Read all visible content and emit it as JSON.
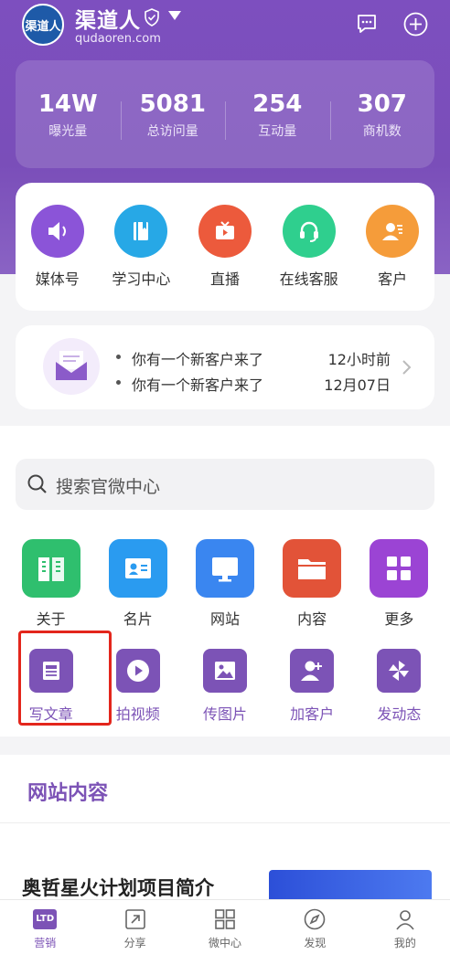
{
  "header": {
    "avatar_text": "渠道人",
    "brand_name": "渠道人",
    "domain": "qudaoren.com"
  },
  "stats": [
    {
      "value": "14W",
      "label": "曝光量"
    },
    {
      "value": "5081",
      "label": "总访问量"
    },
    {
      "value": "254",
      "label": "互动量"
    },
    {
      "value": "307",
      "label": "商机数"
    }
  ],
  "quick_menu": [
    {
      "label": "媒体号",
      "icon": "speaker-icon",
      "color": "#8b54d8"
    },
    {
      "label": "学习中心",
      "icon": "book-icon",
      "color": "#27a8e6"
    },
    {
      "label": "直播",
      "icon": "tv-icon",
      "color": "#ec5a3c"
    },
    {
      "label": "在线客服",
      "icon": "headset-icon",
      "color": "#2fcf8e"
    },
    {
      "label": "客户",
      "icon": "customer-icon",
      "color": "#f59c3a"
    }
  ],
  "notices": [
    {
      "text": "你有一个新客户来了",
      "time": "12小时前"
    },
    {
      "text": "你有一个新客户来了",
      "time": "12月07日"
    }
  ],
  "search": {
    "placeholder": "搜索官微中心"
  },
  "apps": [
    {
      "label": "关于",
      "icon": "building-icon",
      "color": "#2fbf6e"
    },
    {
      "label": "名片",
      "icon": "card-icon",
      "color": "#2a9bf0"
    },
    {
      "label": "网站",
      "icon": "monitor-icon",
      "color": "#3a86f0"
    },
    {
      "label": "内容",
      "icon": "folder-icon",
      "color": "#e25338"
    },
    {
      "label": "更多",
      "icon": "grid-icon",
      "color": "#9b44d4"
    }
  ],
  "tools": [
    {
      "label": "写文章",
      "icon": "article-icon"
    },
    {
      "label": "拍视频",
      "icon": "play-icon"
    },
    {
      "label": "传图片",
      "icon": "image-icon"
    },
    {
      "label": "加客户",
      "icon": "add-user-icon"
    },
    {
      "label": "发动态",
      "icon": "pinwheel-icon"
    }
  ],
  "section": {
    "title": "网站内容",
    "article_title": "奥哲星火计划项目简介"
  },
  "tabs": [
    {
      "label": "营销",
      "icon": "ltd-icon",
      "badge": "LTD",
      "active": true
    },
    {
      "label": "分享",
      "icon": "share-icon",
      "active": false
    },
    {
      "label": "微中心",
      "icon": "grid-icon",
      "active": false
    },
    {
      "label": "发现",
      "icon": "compass-icon",
      "active": false
    },
    {
      "label": "我的",
      "icon": "user-icon",
      "active": false
    }
  ],
  "colors": {
    "brand": "#7c53b6",
    "highlight": "#e3261c"
  }
}
